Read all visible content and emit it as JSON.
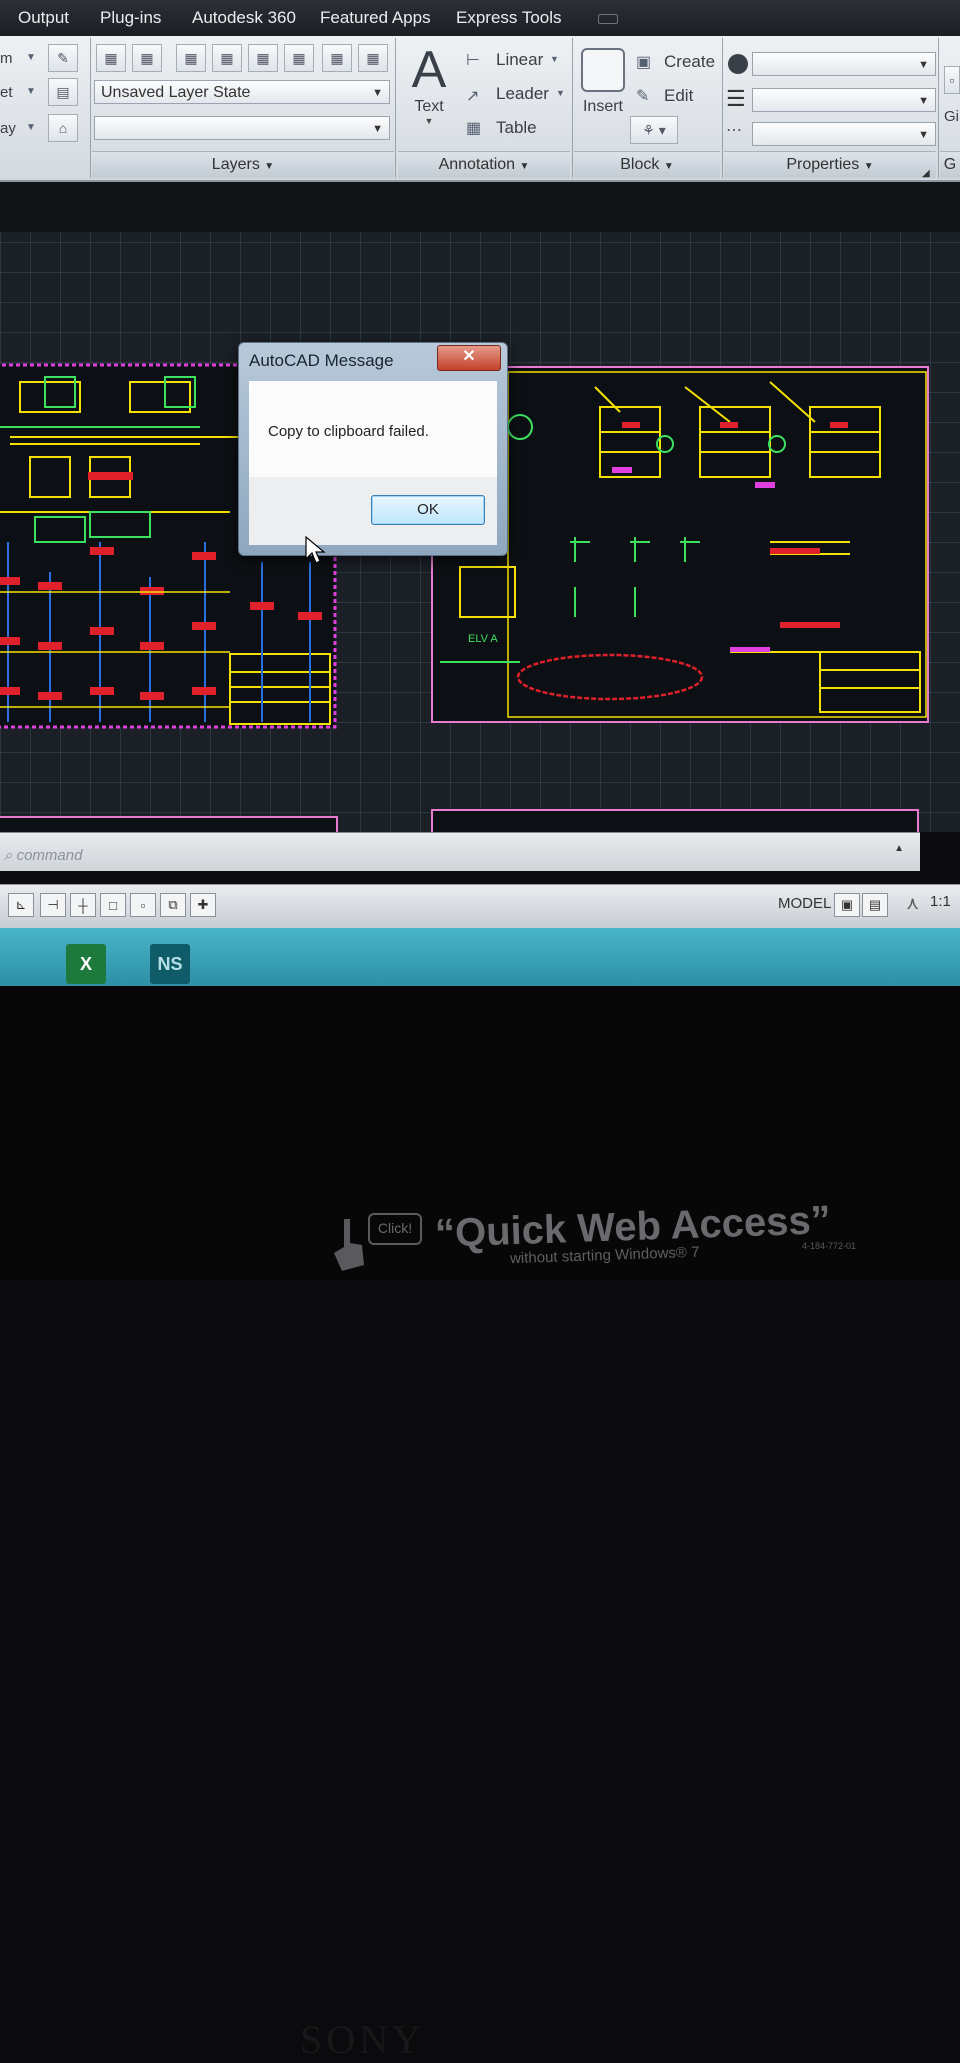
{
  "ribbon": {
    "tabs": [
      "Output",
      "Plug-ins",
      "Autodesk 360",
      "Featured Apps",
      "Express Tools"
    ],
    "left_partial_labels": [
      "m",
      "et",
      "ay"
    ],
    "layers": {
      "layer_state": "Unsaved Layer State",
      "second_dropdown": "",
      "title": "Layers"
    },
    "annotation": {
      "text_label": "Text",
      "linear_label": "Linear",
      "leader_label": "Leader",
      "table_label": "Table",
      "title": "Annotation"
    },
    "block": {
      "insert_label": "Insert",
      "create_label": "Create",
      "edit_label": "Edit",
      "title": "Block"
    },
    "properties": {
      "title": "Properties"
    },
    "groups_partial": "Gi",
    "groups_partial_title": "G"
  },
  "dialog": {
    "title": "AutoCAD Message",
    "close_label": "✕",
    "message": "Copy to clipboard failed.",
    "ok_label": "OK"
  },
  "drawing": {
    "elevation_label": "ELV A"
  },
  "command_line": {
    "placeholder": "command"
  },
  "status_bar": {
    "model_label": "MODEL",
    "scale_label": "1:1"
  },
  "taskbar": {
    "apps": [
      "X",
      "NS"
    ]
  },
  "monitor": {
    "brand": "SONY",
    "sticker_click": "Click!",
    "sticker_title": "“Quick Web Access”",
    "sticker_subtitle": "without starting Windows® 7",
    "sticker_part_no": "4-184-772-01"
  },
  "colors": {
    "accent_blue": "#3c7fb1",
    "close_red": "#c2412a",
    "cad_yellow": "#f5e100",
    "cad_magenta": "#e040e0",
    "cad_green": "#3ee060"
  }
}
